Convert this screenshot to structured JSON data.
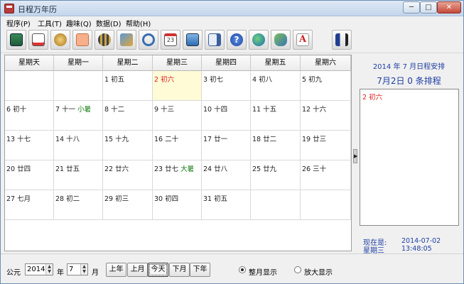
{
  "window": {
    "title": "日程万年历",
    "min_glyph": "─",
    "max_glyph": "□",
    "close_glyph": "✕"
  },
  "menu": [
    "程序(P)",
    "工具(T)",
    "趣味(Q)",
    "数据(D)",
    "帮助(H)"
  ],
  "toolbar": {
    "icons": [
      "calculator-icon",
      "notepad-icon",
      "money-bag-icon",
      "note-icon",
      "film-icon",
      "import-icon",
      "magnifier-icon",
      "calendar-icon",
      "monitor-icon",
      "export-icon",
      "help-icon",
      "globe-icon",
      "user-search-icon",
      "font-icon",
      "exit-icon"
    ],
    "calendar_icon_text": "23",
    "help_icon_text": "?",
    "font_icon_text": "A"
  },
  "calendar": {
    "weekdays": [
      "星期天",
      "星期一",
      "星期二",
      "星期三",
      "星期四",
      "星期五",
      "星期六"
    ],
    "weeks": [
      [
        null,
        null,
        {
          "d": "1 初五"
        },
        {
          "d": "2 初六",
          "today": true
        },
        {
          "d": "3 初七"
        },
        {
          "d": "4 初八"
        },
        {
          "d": "5 初九"
        }
      ],
      [
        {
          "d": "6 初十"
        },
        {
          "d": "7 十一",
          "solar": "小暑"
        },
        {
          "d": "8 十二"
        },
        {
          "d": "9 十三"
        },
        {
          "d": "10 十四"
        },
        {
          "d": "11 十五"
        },
        {
          "d": "12 十六"
        }
      ],
      [
        {
          "d": "13 十七"
        },
        {
          "d": "14 十八"
        },
        {
          "d": "15 十九"
        },
        {
          "d": "16 二十"
        },
        {
          "d": "17 廿一"
        },
        {
          "d": "18 廿二"
        },
        {
          "d": "19 廿三"
        }
      ],
      [
        {
          "d": "20 廿四"
        },
        {
          "d": "21 廿五"
        },
        {
          "d": "22 廿六"
        },
        {
          "d": "23 廿七",
          "solar": "大暑"
        },
        {
          "d": "24 廿八"
        },
        {
          "d": "25 廿九"
        },
        {
          "d": "26 三十"
        }
      ],
      [
        {
          "d": "27 七月"
        },
        {
          "d": "28 初二"
        },
        {
          "d": "29 初三"
        },
        {
          "d": "30 初四"
        },
        {
          "d": "31 初五"
        },
        null,
        null
      ]
    ],
    "today_color": "#fffbd6",
    "today_text_color": "#e02020",
    "solar_term_color": "#1a7f1a"
  },
  "right_panel": {
    "month_title": "2014 年 7 月日程安排",
    "day_summary": "7月2日 0 条排程",
    "event_item": "2 初六",
    "now_label": "现在是:",
    "now_date": "2014-07-02",
    "weekday_label": "星期三",
    "now_time": "13:48:05",
    "text_color": "#1f3fa3"
  },
  "bottom": {
    "era_label": "公元",
    "year_value": "2014",
    "year_label": "年",
    "month_value": "7",
    "month_label": "月",
    "buttons": [
      "上年",
      "上月",
      "今天",
      "下月",
      "下年"
    ],
    "active_button": "今天",
    "radio_month": "整月显示",
    "radio_zoom": "放大显示",
    "spin_arrow_up": "▲",
    "spin_arrow_down": "▼"
  },
  "splitter_arrow": "▶"
}
